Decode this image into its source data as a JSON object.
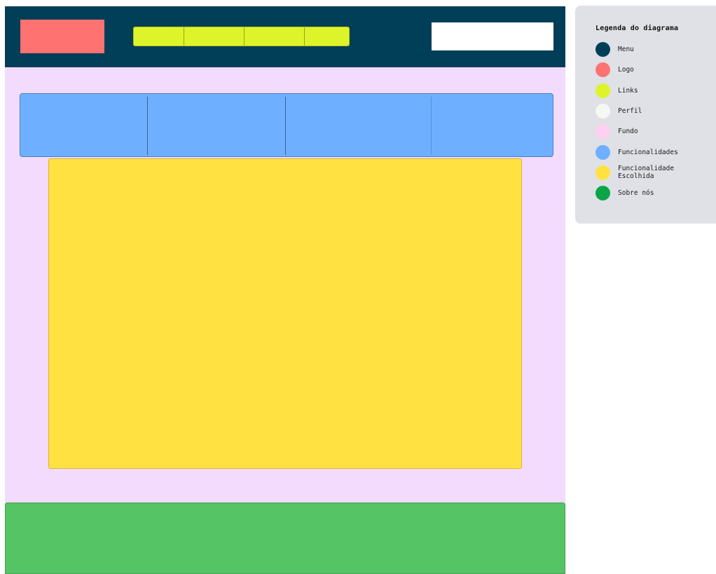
{
  "diagram": {
    "colors": {
      "menu": "#013E58",
      "logo": "#FF7272",
      "links": "#DDF42A",
      "perfil": "#FFFFFF",
      "fundo": "#F2DBFC",
      "funcionalidades": "#6EB0FF",
      "funcionalidade_escolhida": "#FFE241",
      "sobre_nos": "#55C465"
    }
  },
  "legend": {
    "title": "Legenda do diagrama",
    "items": [
      {
        "label": "Menu",
        "color": "#013E58"
      },
      {
        "label": "Logo",
        "color": "#FF7272"
      },
      {
        "label": "Links",
        "color": "#DDF42A"
      },
      {
        "label": "Perfil",
        "color": "#F6F8F4"
      },
      {
        "label": "Fundo",
        "color": "#FFD0F0"
      },
      {
        "label": "Funcionalidades",
        "color": "#6EB0FF"
      },
      {
        "label": "Funcionalidade Escolhida",
        "color": "#FFE241"
      },
      {
        "label": "Sobre nós",
        "color": "#0BA548"
      }
    ]
  }
}
